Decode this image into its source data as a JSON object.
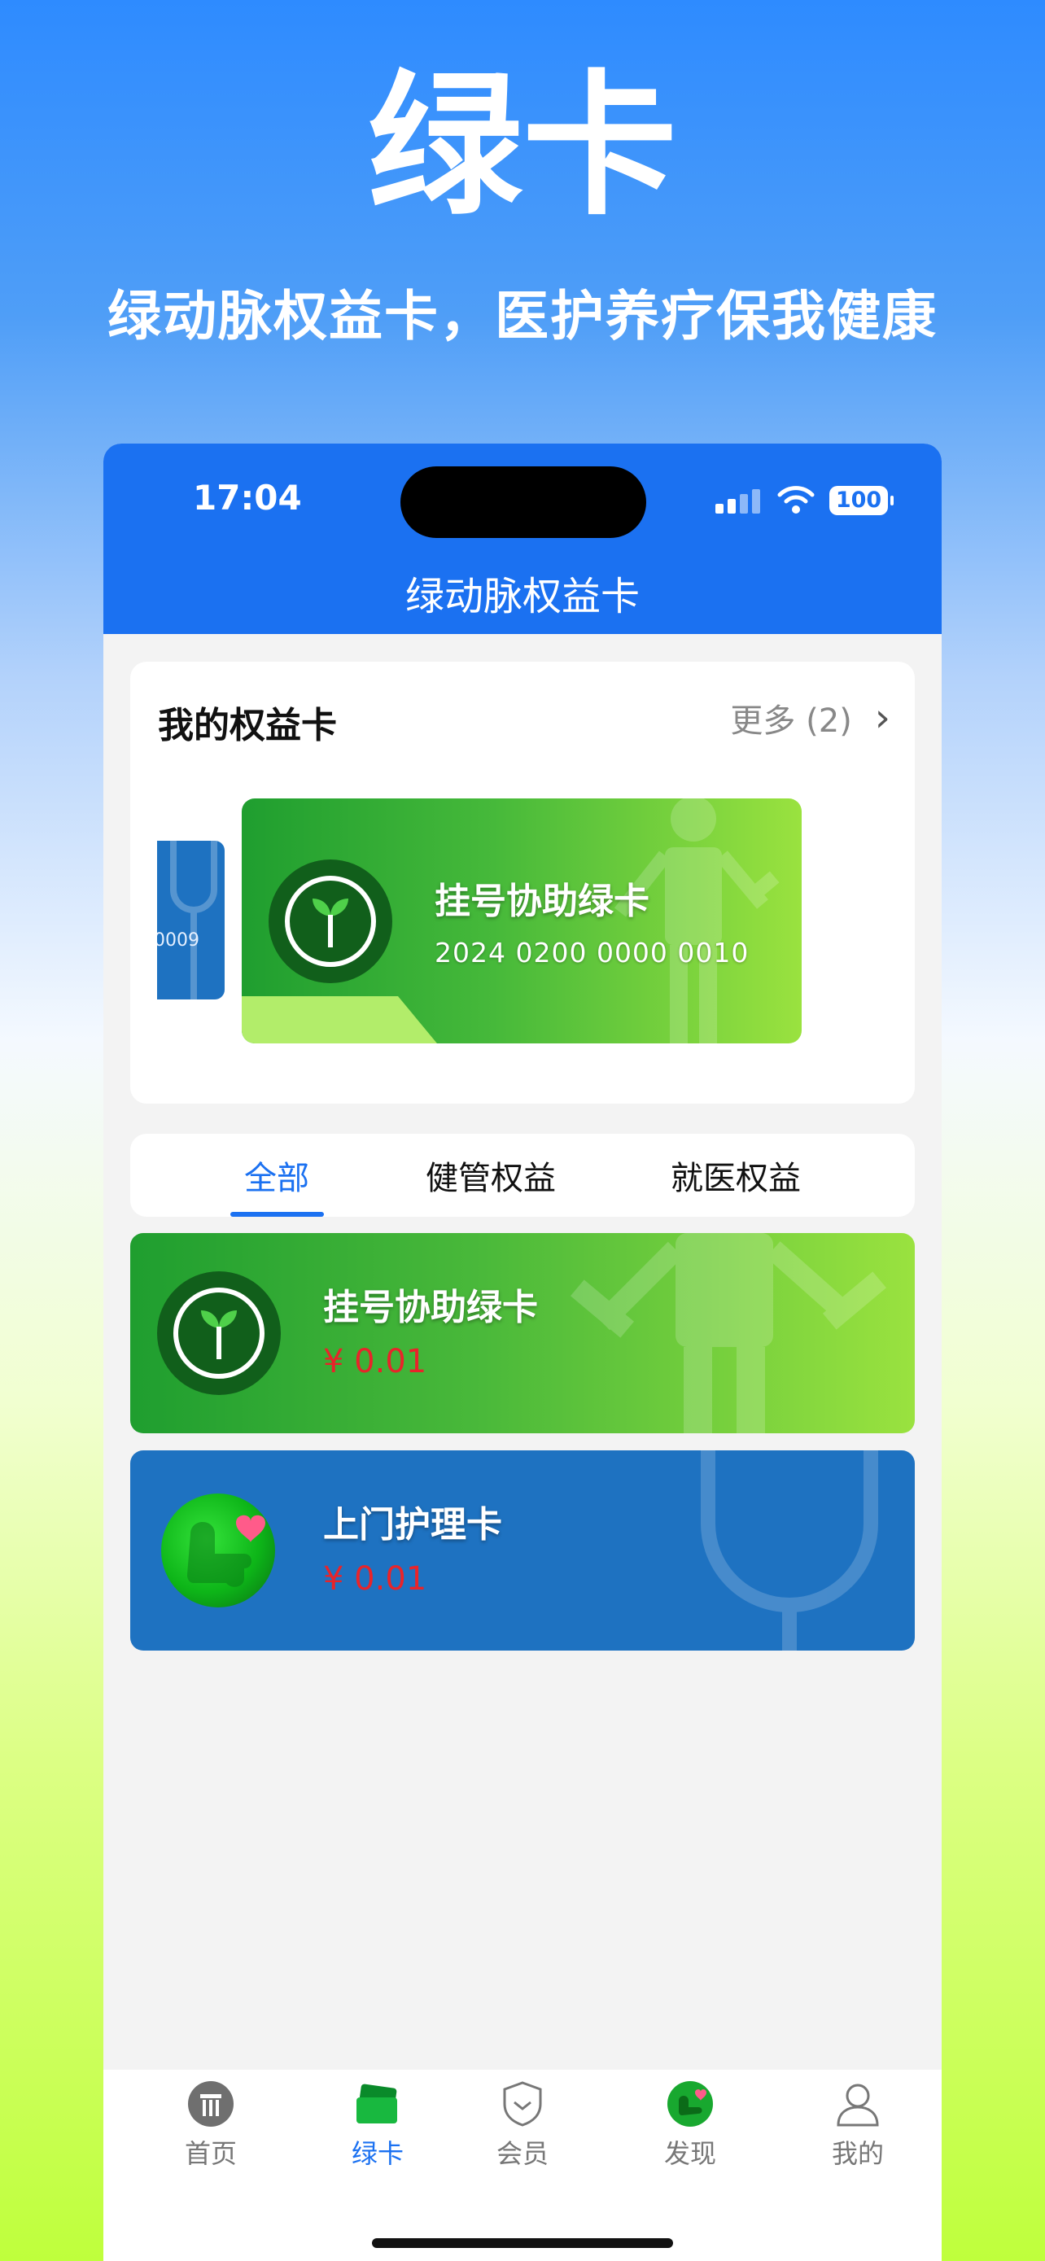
{
  "promo": {
    "title": "绿卡",
    "subtitle": "绿动脉权益卡，医护养疗保我健康"
  },
  "status_bar": {
    "time": "17:04",
    "battery": "100"
  },
  "nav_bar": {
    "title": "绿动脉权益卡"
  },
  "my_cards": {
    "title": "我的权益卡",
    "more_label": "更多 (2)",
    "partial_card_number": "0009",
    "featured_card": {
      "name": "挂号协助绿卡",
      "number": "2024 0200 0000 0010"
    }
  },
  "tabs": [
    {
      "label": "全部",
      "active": true
    },
    {
      "label": "健管权益",
      "active": false
    },
    {
      "label": "就医权益",
      "active": false
    }
  ],
  "list": [
    {
      "name": "挂号协助绿卡",
      "price": "¥ 0.01",
      "color": "#1f9e2f"
    },
    {
      "name": "上门护理卡",
      "price": "¥ 0.01",
      "color": "#1e72c1"
    }
  ],
  "bottom_nav": [
    {
      "label": "首页",
      "icon": "home-icon",
      "active": false
    },
    {
      "label": "绿卡",
      "icon": "card-icon",
      "active": true
    },
    {
      "label": "会员",
      "icon": "shield-icon",
      "active": false
    },
    {
      "label": "发现",
      "icon": "discover-icon",
      "active": false
    },
    {
      "label": "我的",
      "icon": "person-icon",
      "active": false
    }
  ],
  "colors": {
    "accent": "#1b71f1",
    "price": "#e8242a",
    "green_card": "#1f9e2f",
    "blue_card": "#1e72c1"
  }
}
